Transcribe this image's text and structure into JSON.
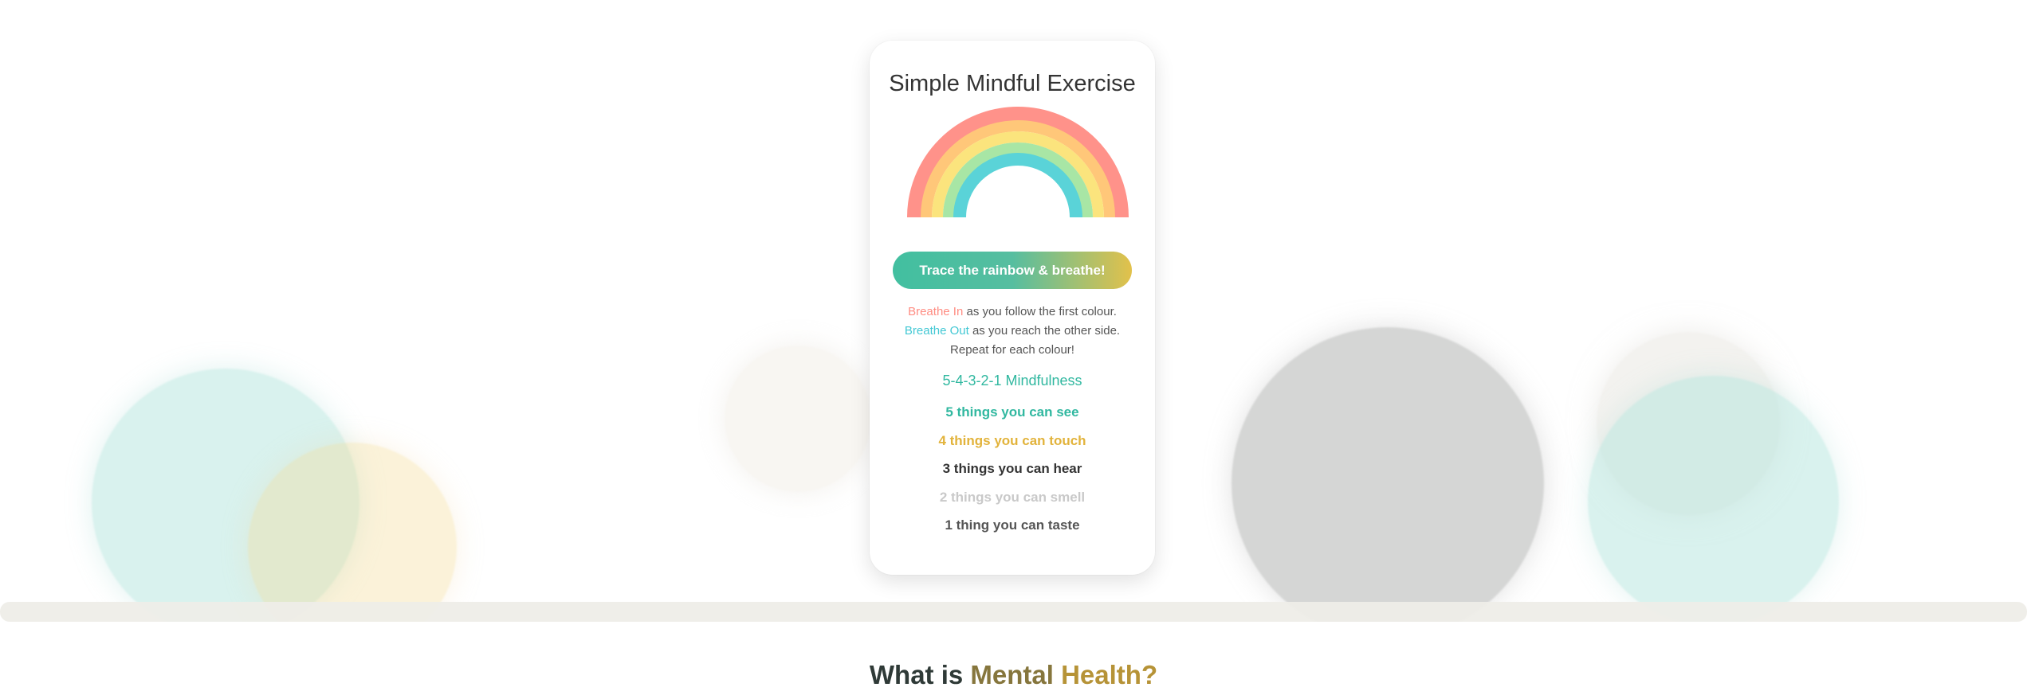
{
  "card": {
    "title": "Simple Mindful Exercise",
    "rainbow_icon": "rainbow-icon",
    "button_label": "Trace the rainbow & breathe!",
    "instructions": {
      "breathe_in": "Breathe In",
      "breathe_in_rest": " as you follow the first colour.",
      "breathe_out": "Breathe Out",
      "breathe_out_rest": " as you reach the other side.",
      "repeat": "Repeat for each colour!"
    },
    "mindfulness_heading": "5-4-3-2-1 Mindfulness",
    "senses": [
      "5 things you can see",
      "4 things you can touch",
      "3 things you can hear",
      "2 things you can smell",
      "1 thing you can taste"
    ]
  },
  "section": {
    "heading_prefix": "What is ",
    "heading_mental": "Mental",
    "heading_space": " ",
    "heading_health": "Health?"
  },
  "colors": {
    "rainbow": [
      "#ff928a",
      "#ffc779",
      "#fbe47d",
      "#a8e6a5",
      "#5ad3d8"
    ],
    "primary_teal": "#31b8a0",
    "button_gradient_end": "#e2c14b",
    "breathe_in": "#ff8c82",
    "breathe_out": "#42c8d4",
    "heading_mental": "#86763d",
    "heading_health": "#b69337"
  }
}
